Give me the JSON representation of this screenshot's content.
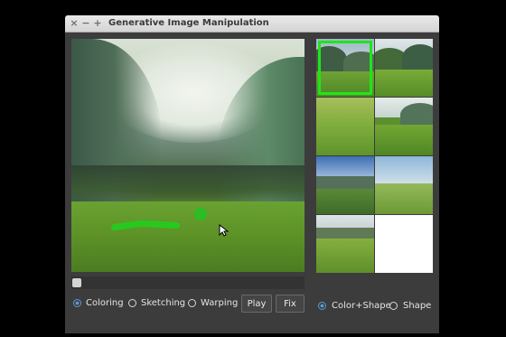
{
  "window": {
    "title": "Generative Image Manipulation",
    "titlebar_buttons": [
      "×",
      "−",
      "+"
    ]
  },
  "canvas": {
    "brush_color": "#27c91f",
    "slider_value": 0
  },
  "controls": {
    "modes": [
      {
        "label": "Coloring",
        "selected": true
      },
      {
        "label": "Sketching",
        "selected": false
      },
      {
        "label": "Warping",
        "selected": false
      }
    ],
    "play_label": "Play",
    "fix_label": "Fix",
    "constraints": [
      {
        "label": "Color+Shape",
        "selected": true
      },
      {
        "label": "Shape",
        "selected": false
      }
    ]
  },
  "results": {
    "count": 8,
    "selected_index": 0,
    "selection_color": "#1fe51a"
  }
}
